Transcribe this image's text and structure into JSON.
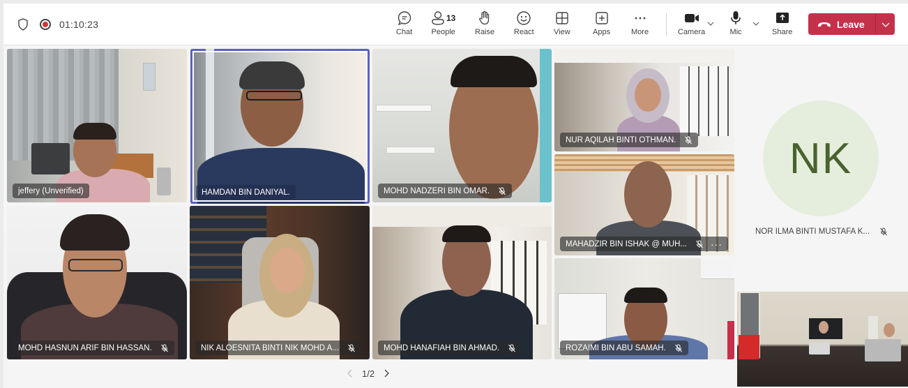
{
  "meeting": {
    "timer": "01:10:23",
    "recording": true,
    "page_indicator": "1/2"
  },
  "toolbar": {
    "chat": "Chat",
    "people": "People",
    "people_count": "13",
    "raise": "Raise",
    "react": "React",
    "view": "View",
    "apps": "Apps",
    "more": "More",
    "camera": "Camera",
    "mic": "Mic",
    "share": "Share",
    "leave": "Leave"
  },
  "colors": {
    "leave_red": "#c4314b",
    "active_speaker": "#5b5fc7",
    "record_red": "#d13438",
    "avatar_bg": "#e5eedc",
    "avatar_fg": "#4a6130"
  },
  "participants": [
    {
      "name": "jeffery (Unverified)",
      "muted": false,
      "video": true
    },
    {
      "name": "HAMDAN BIN DANIYAL.",
      "muted": false,
      "video": true,
      "active_speaker": true
    },
    {
      "name": "MOHD NADZERI BIN OMAR.",
      "muted": true,
      "video": true
    },
    {
      "name": "NUR AQILAH BINTI OTHMAN.",
      "muted": true,
      "video": true
    },
    {
      "name": "MAHADZIR BIN ISHAK @ MUH...",
      "muted": true,
      "video": true,
      "has_more_menu": true
    },
    {
      "name": "MOHD HASNUN ARIF BIN HASSAN.",
      "muted": true,
      "video": true
    },
    {
      "name": "NIK ALOESNITA BINTI NIK MOHD A...",
      "muted": true,
      "video": true
    },
    {
      "name": "MOHD HANAFIAH BIN AHMAD.",
      "muted": true,
      "video": true
    },
    {
      "name": "ROZAIMI BIN ABU SAMAH.",
      "muted": true,
      "video": true
    },
    {
      "name": "NOR ILMA BINTI MUSTAFA K...",
      "muted": true,
      "video": false,
      "initials": "NK"
    }
  ]
}
